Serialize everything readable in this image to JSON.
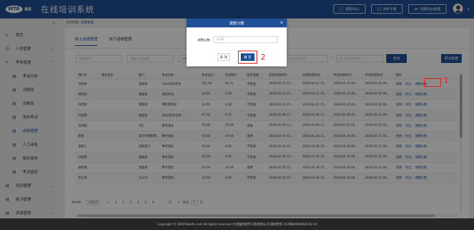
{
  "header": {
    "logo_text": "MTA",
    "logo_sub": "集团",
    "title": "在线培训系统",
    "actions": [
      {
        "icon": "help-icon",
        "label": "帮助中心"
      },
      {
        "icon": "app-download-icon",
        "label": "APP下载"
      },
      {
        "icon": "switch-icon",
        "label": "切换前台管理"
      }
    ]
  },
  "sidebar": {
    "items": [
      {
        "label": "首页",
        "icon": "home-icon"
      },
      {
        "label": "人员管理",
        "icon": "user-icon",
        "expandable": true
      },
      {
        "label": "考务管理",
        "icon": "exam-icon",
        "expandable": true,
        "expanded": true
      },
      {
        "label": "考试分析",
        "icon": "analysis-icon",
        "sub": true
      },
      {
        "label": "试题库",
        "icon": "question-bank-icon",
        "sub": true
      },
      {
        "label": "试卷库",
        "icon": "paper-icon",
        "sub": true
      },
      {
        "label": "发布考试",
        "icon": "publish-icon",
        "sub": true
      },
      {
        "label": "成绩管理",
        "icon": "score-icon",
        "sub": true,
        "active": true
      },
      {
        "label": "人工阅卷",
        "icon": "grading-icon",
        "sub": true
      },
      {
        "label": "报名审核",
        "icon": "signup-icon",
        "sub": true
      },
      {
        "label": "考试监控",
        "icon": "monitor-icon",
        "sub": true
      },
      {
        "label": "培训管理",
        "icon": "training-icon",
        "expandable": true
      },
      {
        "label": "练习管理",
        "icon": "practice-icon",
        "expandable": true
      },
      {
        "label": "资源管理",
        "icon": "resource-icon",
        "expandable": true
      }
    ]
  },
  "breadcrumb": {
    "parent": "考务管理",
    "separator": "/",
    "current": "成绩管理"
  },
  "tabs": [
    "线上成绩管理",
    "线下成绩管理"
  ],
  "filters": {
    "f1": "请选择部门",
    "f2": "请输入考试名称",
    "f3": "请输入姓名",
    "f4": "请选择考试状态",
    "start_time": "考试开始时间",
    "end_time": "考试结束时间",
    "query_label": "查询",
    "export_label": "导出数据"
  },
  "table": {
    "columns": [
      "用户名",
      "真实姓名",
      "部门",
      "考试名称",
      "考试总分",
      "考试得分",
      "是否及格",
      "答卷开始时间",
      "答卷结束时间",
      "考试开始时间",
      "考试结束时间",
      "操作"
    ],
    "rows": [
      [
        "归档审",
        "",
        "客服部",
        "2020年外宣考",
        "101.00",
        "10.11",
        "不及格",
        "2020.04.21 15...",
        "2020.04.21 15...",
        "2020.04.20 00...",
        "2020.04.30 00..."
      ],
      [
        "张阳阳",
        "",
        "客服部",
        "测试考试",
        "10.00",
        "0.00",
        "不及格",
        "2020.04.21 15...",
        "2020.04.21 15...",
        "2020.04.20 00...",
        "2020.04.30 00..."
      ],
      [
        "归档审",
        "",
        "客服部",
        "判断题测试",
        "10.00",
        "0.00",
        "不及格",
        "2020.04.21 15...",
        "2020.04.21 15...",
        "2020.04.20 00...",
        "2020.04.30 00..."
      ],
      [
        "归档审",
        "",
        "客服部",
        "2020年外宣考...",
        "45.00",
        "6.25",
        "不及格",
        "2020.05.08 17...",
        "2020.05.08 17...",
        "2020.05.08 00...",
        "2020.05.21 00..."
      ],
      [
        "深圳照",
        "",
        "1组",
        "降考测试",
        "10.00",
        "10.00",
        "及格",
        "2020.05.09 11...",
        "2020.05.09 11...",
        "2020.05.01 00...",
        "2020.05.31 00..."
      ],
      [
        "韩语",
        "",
        "安全环保管理...",
        "降考测试",
        "10.00",
        "10.00",
        "及格",
        "2020.04.30 15...",
        "2020.04.30 15...",
        "2020.04.20 00...",
        "2020.05.31 00..."
      ],
      [
        "客服二",
        "",
        "机能部门",
        "降考测试",
        "10.00",
        "0.00",
        "不及格",
        "2020.04.30 15...",
        "2020.04.30 15...",
        "2020.04.20 00...",
        "2020.05.31 00..."
      ],
      [
        "归档审",
        "",
        "客服部",
        "降考测试",
        "10.00",
        "0.00",
        "不及格",
        "2020.04.30 15...",
        "2020.04.30 15...",
        "2020.04.20 00...",
        "2020.05.31 00..."
      ],
      [
        "姚明明",
        "",
        "客服部",
        "降考测试",
        "10.00",
        "10.00",
        "及格",
        "2020.04.30 15...",
        "2020.04.30 15...",
        "2020.04.20 00...",
        "2020.05.31 00..."
      ],
      [
        "余兰萍",
        "",
        "分公司",
        "降考测试",
        "10.00",
        "0.00",
        "不及格",
        "2020.04.30 15...",
        "2020.04.30 15...",
        "2020.04.20 00...",
        "2020.05.31 00..."
      ]
    ],
    "ops": [
      "查看",
      "导出",
      "调整分数"
    ]
  },
  "pager": {
    "total": "共96条",
    "page_size": "10条/页",
    "prev": "<",
    "pages": [
      "1",
      "2",
      "3",
      "4",
      "5",
      "6",
      "...",
      "11"
    ],
    "next": ">",
    "goto_prefix": "前往",
    "goto_value": "1",
    "goto_suffix": "页"
  },
  "modal": {
    "title": "调整分数",
    "close": "×",
    "field_label": "调整分数:",
    "field_value": "0.00",
    "cancel_label": "取 消",
    "ok_label": "确 定"
  },
  "annotations": {
    "n1": "1",
    "n2": "2"
  },
  "footer": {
    "text": "Copyright © 2019 Beefs.com All rights reserved 大连陆利软件工程有限公司 版权所有 [ICP备09020041号-19"
  },
  "colors": {
    "primary": "#1f4f96",
    "highlight": "#e02020",
    "footer_bg": "#262626"
  }
}
